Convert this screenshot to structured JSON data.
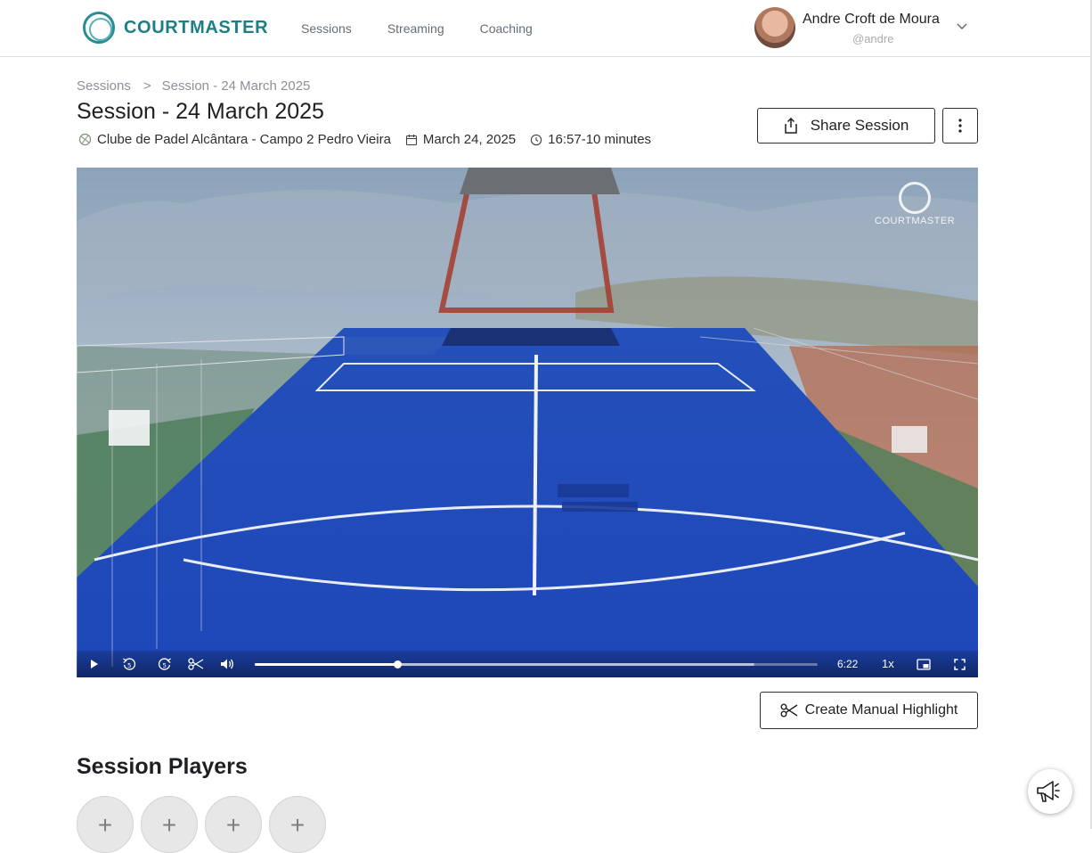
{
  "header": {
    "brand": "COURTMASTER",
    "nav": [
      {
        "label": "Sessions"
      },
      {
        "label": "Streaming"
      },
      {
        "label": "Coaching"
      }
    ],
    "user": {
      "name": "Andre Croft de Moura",
      "handle": "@andre"
    }
  },
  "breadcrumb": {
    "root": "Sessions",
    "separator": ">",
    "current": "Session - 24 March 2025"
  },
  "session": {
    "title": "Session - 24 March 2025",
    "location": "Clube de Padel Alcântara - Campo 2 Pedro Vieira",
    "date": "March 24, 2025",
    "time": "16:57-10 minutes"
  },
  "actions": {
    "share_label": "Share Session",
    "highlight_label": "Create Manual Highlight"
  },
  "player": {
    "watermark": "COURTMASTER",
    "current_time": "6:22",
    "speed": "1x",
    "progress_fraction": 0.253,
    "buffered_fraction": 0.888
  },
  "players_section": {
    "title": "Session Players",
    "slots": [
      "+",
      "+",
      "+",
      "+"
    ]
  },
  "colors": {
    "brand": "#1d7f86",
    "court": "#1f4fc2",
    "text": "#1c1f23"
  }
}
